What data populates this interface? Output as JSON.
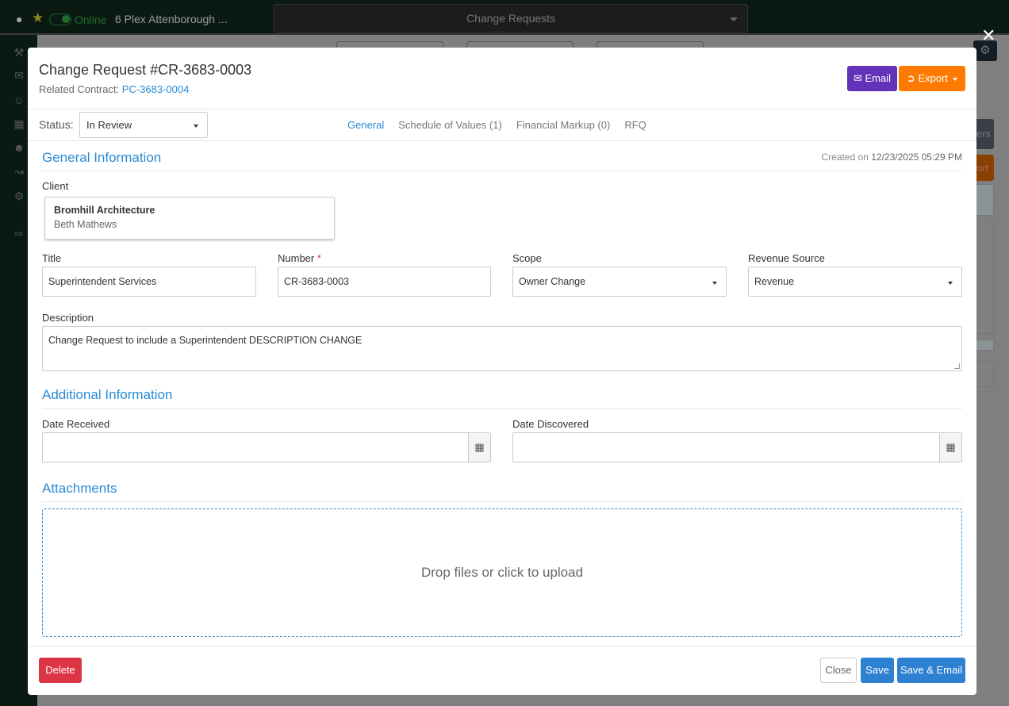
{
  "topbar": {
    "status": "Online",
    "project": "6 Plex Attenborough ...",
    "module": "Change Requests"
  },
  "background": {
    "side_button_1": "ers",
    "side_button_2": "ort"
  },
  "modal": {
    "title": "Change Request #CR-3683-0003",
    "related_label": "Related Contract: ",
    "related_value": "PC-3683-0004",
    "email_label": "Email",
    "export_label": "Export",
    "status_label": "Status:",
    "status_value": "In Review",
    "tabs": [
      {
        "label": "General",
        "active": true
      },
      {
        "label": "Schedule of Values (1)"
      },
      {
        "label": "Financial Markup (0)"
      },
      {
        "label": "RFQ"
      }
    ],
    "general_heading": "General Information",
    "created_label": "Created on ",
    "created_value": "12/23/2025 05:29 PM",
    "client_label": "Client",
    "client_name": "Bromhill Architecture",
    "client_contact": "Beth Mathews",
    "title_label": "Title",
    "title_value": "Superintendent Services",
    "number_label": "Number",
    "number_required": "*",
    "number_value": "CR-3683-0003",
    "scope_label": "Scope",
    "scope_value": "Owner Change",
    "revenue_label": "Revenue Source",
    "revenue_value": "Revenue",
    "description_label": "Description",
    "description_value": "Change Request to include a Superintendent DESCRIPTION CHANGE",
    "additional_heading": "Additional Information",
    "date_received_label": "Date Received",
    "date_received_value": "",
    "date_discovered_label": "Date Discovered",
    "date_discovered_value": "",
    "attachments_heading": "Attachments",
    "dropzone_text": "Drop files or click to upload",
    "delete_label": "Delete",
    "close_label": "Close",
    "save_label": "Save",
    "save_email_label": "Save & Email"
  },
  "colors": {
    "accent": "#2a8ad4",
    "email": "#6232b8",
    "export": "#ff7a00",
    "delete": "#dc3545",
    "save": "#2d80d2"
  }
}
